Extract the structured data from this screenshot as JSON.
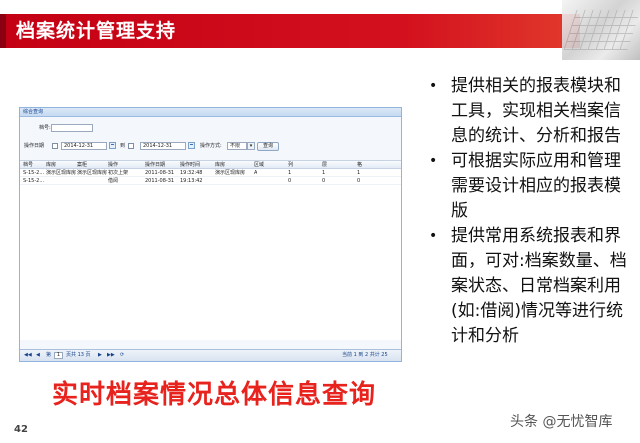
{
  "slide": {
    "title": "档案统计管理支持",
    "caption": "实时档案情况总体信息查询",
    "page_number": "42",
    "watermark": "头条 @无忧智库",
    "colors": {
      "title_band": "#d3111e",
      "caption": "#e8231d"
    }
  },
  "bullets": [
    "提供相关的报表模块和工具，实现相关档案信息的统计、分析和报告",
    "可根据实际应用和管理需要设计相应的报表模版",
    "提供常用系统报表和界面，可对:档案数量、档案状态、日常档案利用(如:借阅)情况等进行统计和分析"
  ],
  "bullet_icon": "bullet-dot",
  "app": {
    "window_title": "综合查询",
    "filters": {
      "archive_no_label": "档号:",
      "archive_no_value": "",
      "op_date_label": "操作日期",
      "date_from": "2014-12-31",
      "to_label": "到",
      "date_to": "2014-12-31",
      "op_mode_label": "操作方式:",
      "op_mode_value": "不限",
      "query_button": "查询"
    },
    "table": {
      "columns": [
        "档号",
        "库房",
        "案柜",
        "操作",
        "操作日期",
        "操作时间",
        "库房",
        "区域",
        "列",
        "层",
        "格"
      ],
      "rows": [
        [
          "S-15-2...",
          "演示区现库房",
          "演示区现库房",
          "初次上架",
          "2011-08-31",
          "19:32:48",
          "演示区现库房",
          "A",
          "1",
          "1",
          "1"
        ],
        [
          "S-15-2...",
          "",
          "",
          "借阅",
          "2011-08-31",
          "19:13:42",
          "",
          "",
          "0",
          "0",
          "0"
        ]
      ]
    },
    "pager": {
      "first": "◀◀",
      "prev": "◀",
      "page_label": "第",
      "page_value": "1",
      "page_total": "页共 13 页",
      "next": "▶",
      "last": "▶▶",
      "refresh": "⟳",
      "status": "当前 1 到 2 共计 25"
    }
  }
}
